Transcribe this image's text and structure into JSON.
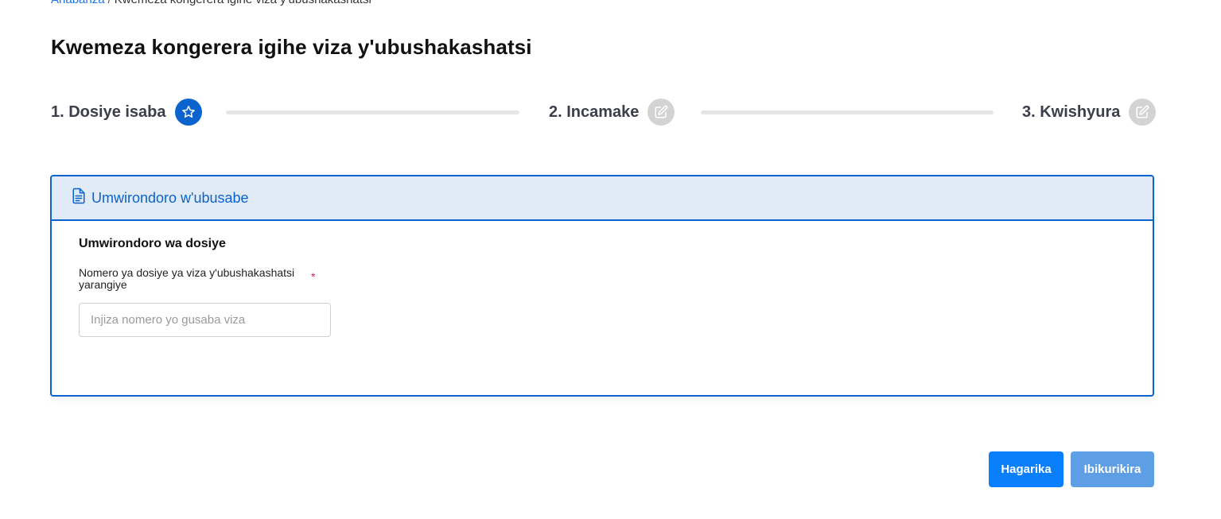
{
  "breadcrumb": {
    "home": "Ahabanza",
    "separator": "/",
    "current": "Kwemeza kongerera igihe viza y'ubushakashatsi"
  },
  "page": {
    "title": "Kwemeza kongerera igihe viza y'ubushakashatsi"
  },
  "stepper": {
    "steps": [
      {
        "label": "1. Dosiye isaba",
        "icon": "star-icon",
        "state": "active"
      },
      {
        "label": "2. Incamake",
        "icon": "edit-icon",
        "state": "inactive"
      },
      {
        "label": "3. Kwishyura",
        "icon": "edit-icon",
        "state": "inactive"
      }
    ]
  },
  "card": {
    "header_icon": "document-icon",
    "header_title": "Umwirondoro w'ubusabe",
    "section_title": "Umwirondoro wa dosiye",
    "field_label": "Nomero ya dosiye ya viza y'ubushakashatsi yarangiye",
    "required_marker": "*",
    "input_placeholder": "Injiza nomero yo gusaba viza",
    "input_value": ""
  },
  "actions": {
    "cancel_label": "Hagarika",
    "submit_label": "Ibikurikira"
  },
  "colors": {
    "primary": "#0b63ce",
    "button_primary": "#0a7ffb",
    "button_disabled": "#5e9ee4",
    "header_bg": "#e1ebf7",
    "required": "#e3195f"
  }
}
